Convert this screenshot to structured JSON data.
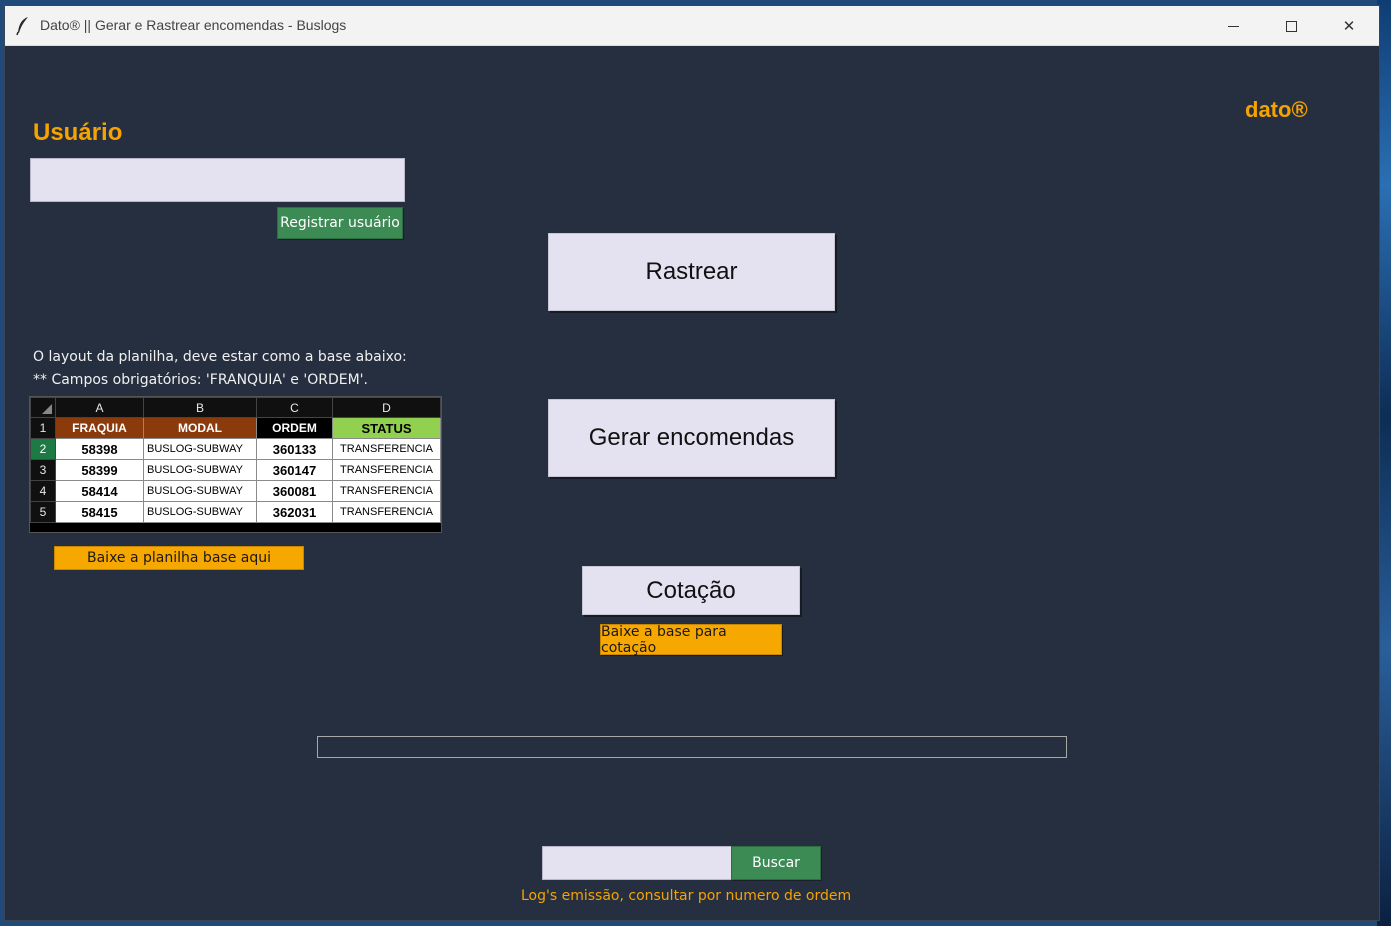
{
  "window": {
    "title": "Dato® || Gerar e Rastrear encomendas - Buslogs",
    "app_icon": "feather-icon",
    "minimize_icon": "minimize-icon",
    "maximize_icon": "maximize-icon",
    "close_icon": "close-icon",
    "close_glyph": "✕"
  },
  "brand": "dato®",
  "user": {
    "title": "Usuário",
    "input_value": "",
    "register_label": "Registrar usuário"
  },
  "actions": {
    "rastrear": "Rastrear",
    "gerar": "Gerar encomendas",
    "cotacao": "Cotação",
    "base_cotacao": "Baixe a base para cotação"
  },
  "info": {
    "line1": "O layout da planilha, deve estar como a base abaixo:",
    "line2": "** Campos obrigatórios: 'FRANQUIA' e 'ORDEM'."
  },
  "sheet": {
    "columns": [
      "A",
      "B",
      "C",
      "D"
    ],
    "headers": [
      "FRAQUIA",
      "MODAL",
      "ORDEM",
      "STATUS"
    ],
    "row_numbers": [
      "1",
      "2",
      "3",
      "4",
      "5"
    ],
    "rows": [
      [
        "58398",
        "BUSLOG-SUBWAY",
        "360133",
        "TRANSFERENCIA"
      ],
      [
        "58399",
        "BUSLOG-SUBWAY",
        "360147",
        "TRANSFERENCIA"
      ],
      [
        "58414",
        "BUSLOG-SUBWAY",
        "360081",
        "TRANSFERENCIA"
      ],
      [
        "58415",
        "BUSLOG-SUBWAY",
        "362031",
        "TRANSFERENCIA"
      ]
    ]
  },
  "planilha_button": "Baixe a planilha base aqui",
  "progress": {
    "value": 0
  },
  "search": {
    "input_value": "",
    "button_label": "Buscar",
    "hint": "Log's emissão, consultar por numero de ordem"
  },
  "colors": {
    "background": "#262f40",
    "accent_orange": "#f5a300",
    "button_green": "#3d8b54",
    "button_light": "#e4e2f1"
  }
}
